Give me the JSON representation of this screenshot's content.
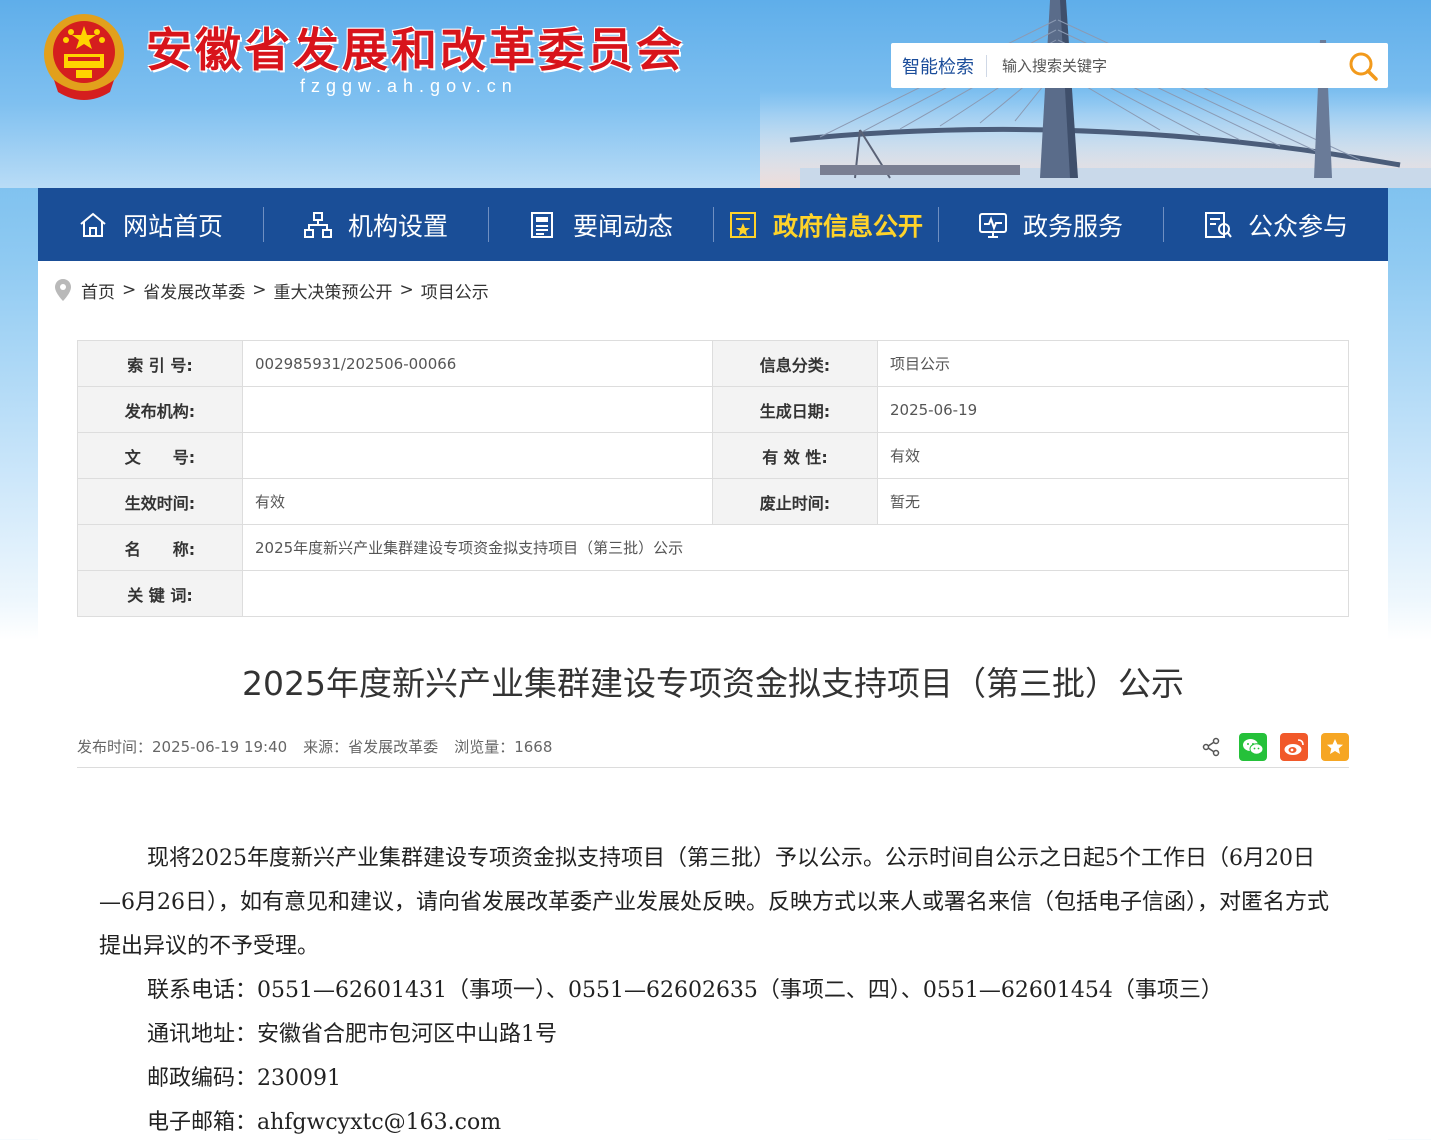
{
  "header": {
    "title": "安徽省发展和改革委员会",
    "domain": "fzggw.ah.gov.cn",
    "search": {
      "label": "智能检索",
      "placeholder": "输入搜索关键字"
    }
  },
  "nav": {
    "items": [
      {
        "label": "网站首页",
        "icon": "home-icon",
        "active": false
      },
      {
        "label": "机构设置",
        "icon": "org-chart-icon",
        "active": false
      },
      {
        "label": "要闻动态",
        "icon": "news-icon",
        "active": false
      },
      {
        "label": "政府信息公开",
        "icon": "gov-info-icon",
        "active": true
      },
      {
        "label": "政务服务",
        "icon": "monitor-icon",
        "active": false
      },
      {
        "label": "公众参与",
        "icon": "participation-icon",
        "active": false
      }
    ]
  },
  "breadcrumb": [
    "首页",
    "省发展改革委",
    "重大决策预公开",
    "项目公示"
  ],
  "meta": {
    "index_label": "索 引 号:",
    "index_value": "002985931/202506-00066",
    "category_label": "信息分类:",
    "category_value": "项目公示",
    "publisher_label": "发布机构:",
    "publisher_value": "",
    "created_label": "生成日期:",
    "created_value": "2025-06-19",
    "docno_label": "文　　号:",
    "docno_value": "",
    "validity_label": "有 效 性:",
    "validity_value": "有效",
    "effective_label": "生效时间:",
    "effective_value": "有效",
    "repeal_label": "废止时间:",
    "repeal_value": "暂无",
    "name_label": "名　　称:",
    "name_value": "2025年度新兴产业集群建设专项资金拟支持项目（第三批）公示",
    "keywords_label": "关 键 词:",
    "keywords_value": ""
  },
  "article": {
    "title": "2025年度新兴产业集群建设专项资金拟支持项目（第三批）公示",
    "publish_time": "发布时间：2025-06-19 19:40",
    "source": "来源：省发展改革委",
    "views": "浏览量：1668",
    "share": [
      "share-icon",
      "wechat-icon",
      "weibo-icon",
      "favorite-icon"
    ],
    "paragraphs": {
      "intro": "现将2025年度新兴产业集群建设专项资金拟支持项目（第三批）予以公示。公示时间自公示之日起5个工作日（6月20日—6月26日），如有意见和建议，请向省发展改革委产业发展处反映。反映方式以来人或署名来信（包括电子信函），对匿名方式提出异议的不予受理。",
      "phone": "联系电话：0551—62601431（事项一）、0551—62602635（事项二、四）、0551—62601454（事项三）",
      "address": "通讯地址：安徽省合肥市包河区中山路1号",
      "postcode": "邮政编码：230091",
      "email": "电子邮箱：ahfgwcyxtc@163.com"
    }
  },
  "colors": {
    "nav_bg": "#1a4e97",
    "nav_active": "#ffd32a",
    "title_red": "#d8141b",
    "wechat": "#25c13a",
    "weibo": "#f1592a",
    "favorite": "#f6a623"
  }
}
